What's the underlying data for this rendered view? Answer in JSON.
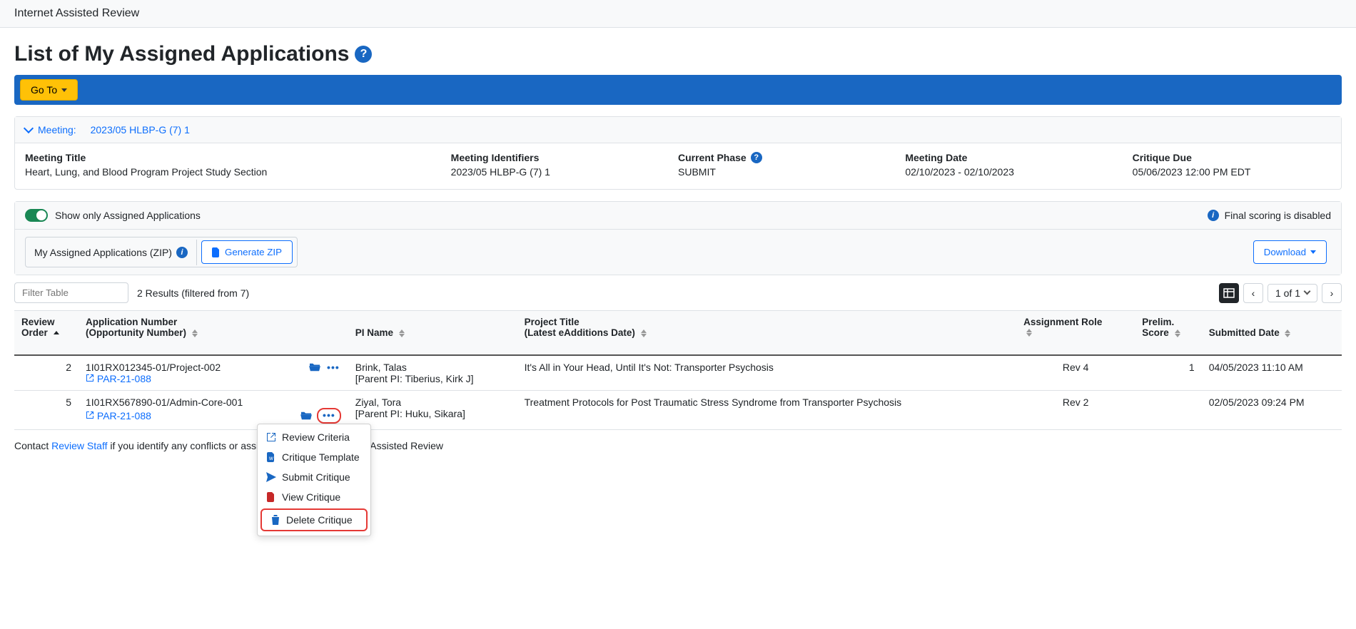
{
  "app_name": "Internet Assisted Review",
  "page_title": "List of My Assigned Applications",
  "goto_label": "Go To",
  "meeting_header": {
    "prefix": "Meeting:",
    "value": "2023/05 HLBP-G (7) 1"
  },
  "meeting_details": {
    "title_label": "Meeting Title",
    "title_value": "Heart, Lung, and Blood Program Project Study Section",
    "identifiers_label": "Meeting Identifiers",
    "identifiers_value": "2023/05 HLBP-G (7) 1",
    "phase_label": "Current Phase",
    "phase_value": "SUBMIT",
    "date_label": "Meeting Date",
    "date_value": "02/10/2023 - 02/10/2023",
    "due_label": "Critique Due",
    "due_value": "05/06/2023 12:00 PM EDT"
  },
  "toggle_label": "Show only Assigned Applications",
  "status_text": "Final scoring is disabled",
  "zip_label": "My Assigned Applications (ZIP)",
  "generate_zip": "Generate ZIP",
  "download_label": "Download",
  "filter_placeholder": "Filter Table",
  "results_text": "2 Results (filtered from 7)",
  "pager_text": "1 of 1",
  "table": {
    "headers": {
      "review_order": "Review Order",
      "app_no_1": "Application Number",
      "app_no_2": "(Opportunity Number)",
      "pi": "PI Name",
      "project_1": "Project Title",
      "project_2": "(Latest eAdditions Date)",
      "role": "Assignment Role",
      "score_1": "Prelim.",
      "score_2": "Score",
      "submitted": "Submitted Date"
    },
    "rows": [
      {
        "order": "2",
        "app_no": "1I01RX012345-01/Project-002",
        "opp_no": "PAR-21-088",
        "pi": "Brink, Talas",
        "parent": "[Parent PI: Tiberius, Kirk J]",
        "title": "It's All in Your Head, Until It's Not: Transporter Psychosis",
        "role": "Rev 4",
        "score": "1",
        "submitted": "04/05/2023 11:10 AM"
      },
      {
        "order": "5",
        "app_no": "1I01RX567890-01/Admin-Core-001",
        "opp_no": "PAR-21-088",
        "pi": "Ziyal, Tora",
        "parent": "[Parent PI: Huku, Sikara]",
        "title": "Treatment Protocols for Post Traumatic Stress Syndrome from Transporter Psychosis",
        "role": "Rev 2",
        "score": "",
        "submitted": "02/05/2023 09:24 PM"
      }
    ]
  },
  "action_menu": {
    "review_criteria": "Review Criteria",
    "critique_template": "Critique Template",
    "submit_critique": "Submit Critique",
    "view_critique": "View Critique",
    "delete_critique": "Delete Critique"
  },
  "footer": {
    "prefix": "Contact ",
    "link": "Review Staff",
    "suffix": " if you identify any conflicts or assignment issues. | Internet Assisted Review"
  }
}
